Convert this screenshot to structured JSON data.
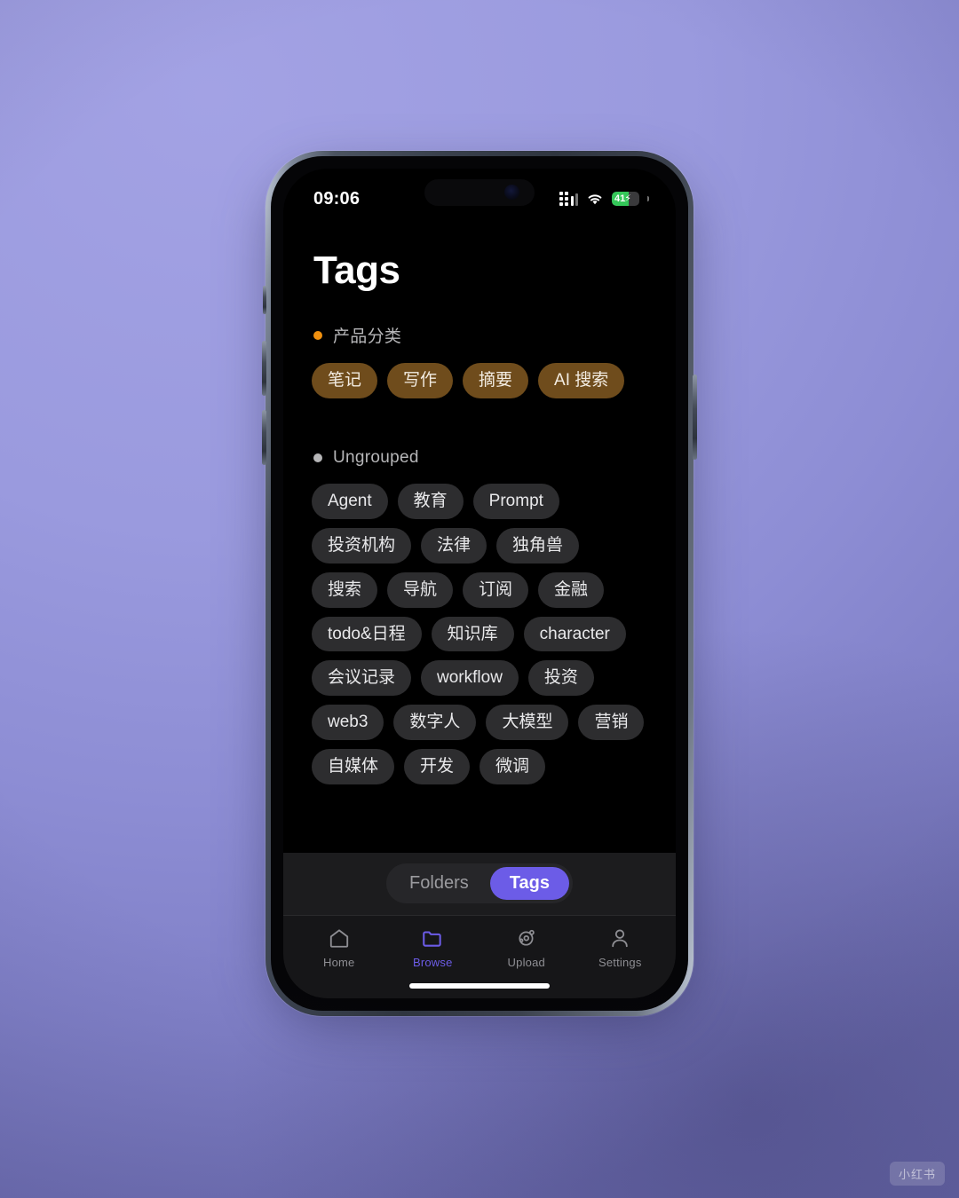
{
  "background": {
    "color_top": "#9a9ade",
    "color_bottom": "#6f6fb4"
  },
  "status_bar": {
    "time": "09:06",
    "cellular_icon": "cellular-signal-icon",
    "wifi_icon": "wifi-icon",
    "battery_level": "41",
    "battery_charging_glyph": "⚡",
    "battery_color": "#34c759"
  },
  "header": {
    "title": "Tags"
  },
  "groups": [
    {
      "label": "产品分类",
      "dot_color": "#f0900f",
      "style": "amber",
      "tags": [
        "笔记",
        "写作",
        "摘要",
        "AI 搜索"
      ]
    },
    {
      "label": "Ungrouped",
      "dot_color": "#b6b6b8",
      "style": "grey",
      "tags": [
        "Agent",
        "教育",
        "Prompt",
        "投资机构",
        "法律",
        "独角兽",
        "搜索",
        "导航",
        "订阅",
        "金融",
        "todo&日程",
        "知识库",
        "character",
        "会议记录",
        "workflow",
        "投资",
        "web3",
        "数字人",
        "大模型",
        "营销",
        "自媒体",
        "开发",
        "微调"
      ]
    }
  ],
  "segmented_control": {
    "options": [
      "Folders",
      "Tags"
    ],
    "selected": "Tags",
    "active_color": "#6c5ce7"
  },
  "tab_bar": {
    "items": [
      {
        "label": "Home",
        "icon": "home-icon",
        "active": false
      },
      {
        "label": "Browse",
        "icon": "folder-icon",
        "active": true
      },
      {
        "label": "Upload",
        "icon": "orbit-upload-icon",
        "active": false
      },
      {
        "label": "Settings",
        "icon": "person-icon",
        "active": false
      }
    ],
    "active_color": "#6c5ce7",
    "inactive_color": "#8e8e93"
  },
  "watermark": {
    "text": "小红书"
  }
}
